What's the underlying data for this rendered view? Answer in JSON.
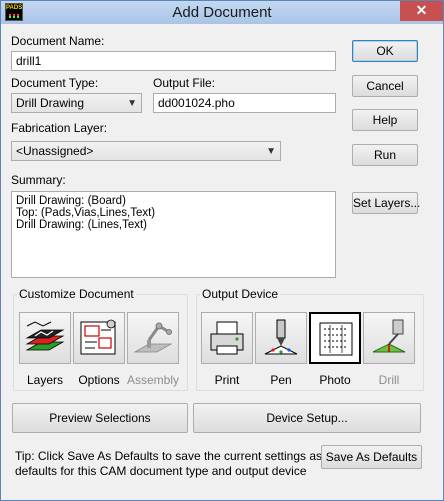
{
  "window": {
    "title": "Add Document",
    "close_glyph": "✕",
    "app_icon_text": "PADS",
    "app_icon_label": "pads-app-icon"
  },
  "fields": {
    "document_name": {
      "label": "Document Name:",
      "value": "drill1"
    },
    "document_type": {
      "label": "Document Type:",
      "value": "Drill Drawing"
    },
    "output_file": {
      "label": "Output File:",
      "value": "dd001024.pho"
    },
    "fabrication_layer": {
      "label": "Fabrication Layer:",
      "value": "<Unassigned>"
    }
  },
  "summary": {
    "label": "Summary:",
    "lines": [
      "Drill Drawing: (Board)",
      "Top: (Pads,Vias,Lines,Text)",
      "Drill Drawing: (Lines,Text)"
    ]
  },
  "buttons": {
    "ok": "OK",
    "cancel": "Cancel",
    "help": "Help",
    "run": "Run",
    "set_layers": "Set Layers...",
    "preview_selections": "Preview Selections",
    "device_setup": "Device Setup...",
    "save_as_defaults": "Save As Defaults"
  },
  "customize_document": {
    "title": "Customize Document",
    "items": [
      {
        "label": "Layers",
        "icon": "layers-icon",
        "enabled": true
      },
      {
        "label": "Options",
        "icon": "options-icon",
        "enabled": true
      },
      {
        "label": "Assembly",
        "icon": "assembly-icon",
        "enabled": false
      }
    ]
  },
  "output_device": {
    "title": "Output Device",
    "selected": "Photo",
    "items": [
      {
        "label": "Print",
        "icon": "printer-icon",
        "enabled": true
      },
      {
        "label": "Pen",
        "icon": "pen-plotter-icon",
        "enabled": true
      },
      {
        "label": "Photo",
        "icon": "photo-plotter-icon",
        "enabled": true
      },
      {
        "label": "Drill",
        "icon": "drill-icon",
        "enabled": false
      }
    ]
  },
  "tip": {
    "line1": "Tip: Click Save As Defaults to save the current settings as the",
    "line2": "defaults for this CAM document type and output device"
  },
  "colors": {
    "titlebar": "#a9c4e6",
    "close": "#c75050",
    "dialog_bg": "#f0f0f0"
  }
}
